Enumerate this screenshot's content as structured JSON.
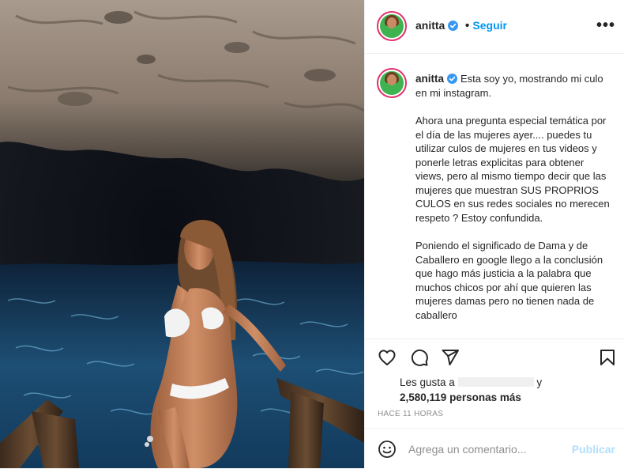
{
  "post": {
    "username": "anitta",
    "follow_label": "Seguir",
    "more_icon": "more-options-icon",
    "caption_paragraphs": [
      "Esta soy yo, mostrando mi culo en mi instagram.",
      "Ahora una pregunta especial temática por el día de las mujeres ayer.... puedes tu utilizar culos de mujeres en tus videos y ponerle letras explicitas para obtener views, pero al mismo tiempo decir que las mujeres que muestran SUS PROPRIOS CULOS en sus redes sociales no merecen respeto ? Estoy confundida.",
      "Poniendo el significado de Dama y de Caballero en google llego a la conclusión que hago más justicia a la palabra que muchos chicos por ahí que quieren las mujeres damas pero no tienen nada de caballero"
    ],
    "likes_prefix": "Les gusta a",
    "likes_conjunction": "y",
    "likes_count_text": "2,580,119 personas más",
    "time_ago": "Hace 11 horas",
    "comment_placeholder": "Agrega un comentario...",
    "publish_label": "Publicar"
  },
  "icons": [
    "heart-icon",
    "comment-icon",
    "share-icon",
    "bookmark-icon",
    "emoji-icon",
    "verified-badge-icon"
  ],
  "colors": {
    "link_blue": "#0095f6",
    "publish_disabled": "#b2dffc",
    "verified_blue": "#3897f0",
    "story_ring": "#e1306c"
  }
}
